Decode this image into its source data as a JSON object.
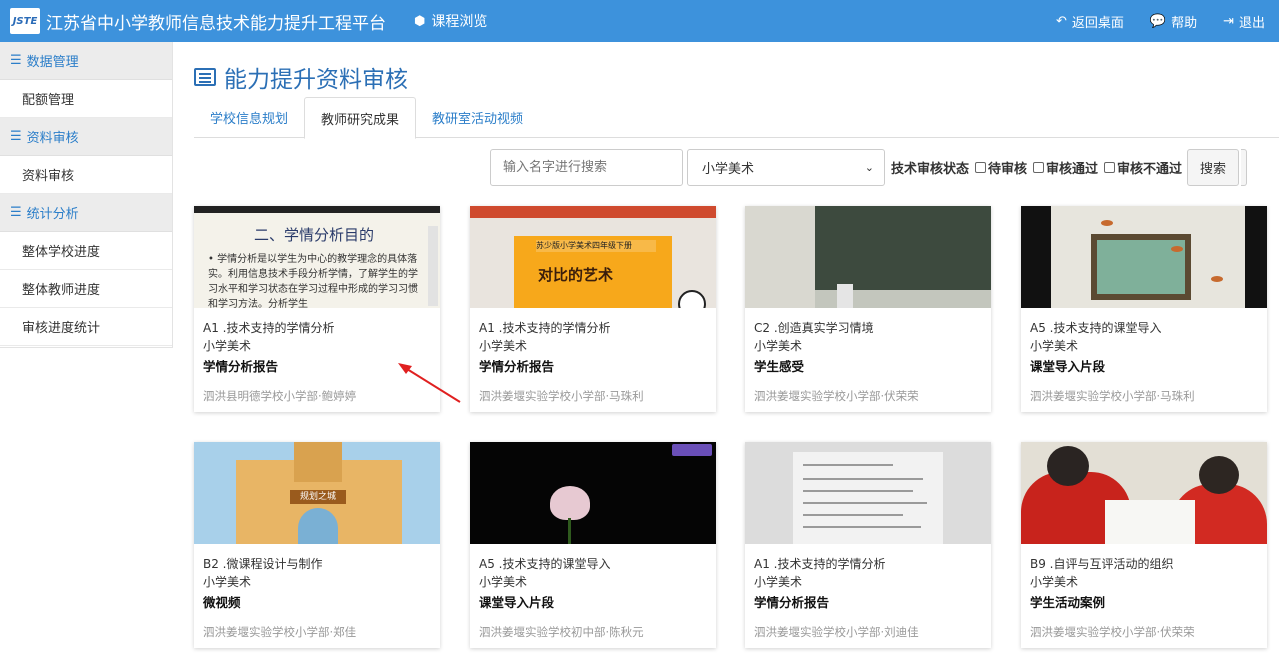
{
  "header": {
    "logo_text": "JSTE",
    "site_title": "江苏省中小学教师信息技术能力提升工程平台",
    "course_nav": "课程浏览",
    "links": [
      {
        "label": "返回桌面",
        "icon": "return-icon"
      },
      {
        "label": "帮助",
        "icon": "chat-bubble-icon"
      },
      {
        "label": "退出",
        "icon": "sign-out-icon"
      }
    ]
  },
  "sidebar": {
    "groups": [
      {
        "label": "数据管理",
        "items": [
          "配额管理"
        ]
      },
      {
        "label": "资料审核",
        "items": [
          "资料审核"
        ]
      },
      {
        "label": "统计分析",
        "items": [
          "整体学校进度",
          "整体教师进度",
          "审核进度统计"
        ]
      }
    ]
  },
  "page_title": "能力提升资料审核",
  "tabs": [
    {
      "label": "学校信息规划",
      "active": false
    },
    {
      "label": "教师研究成果",
      "active": true
    },
    {
      "label": "教研室活动视频",
      "active": false
    }
  ],
  "filters": {
    "search_placeholder": "输入名字进行搜索",
    "subject_selected": "小学美术",
    "status_label": "技术审核状态",
    "status_options": [
      "待审核",
      "审核通过",
      "审核不通过"
    ],
    "search_button": "搜索"
  },
  "cards": [
    {
      "code": "A1 .技术支持的学情分析",
      "subject": "小学美术",
      "title": "学情分析报告",
      "author": "泗洪县明德学校小学部·鲍婷婷",
      "thumb_heading": "二、学情分析目的",
      "thumb_text": "• 学情分析是以学生为中心的教学理念的具体落实。利用信息技术手段分析学情，了解学生的学习水平和学习状态在学习过程中形成的学习习惯和学习方法。分析学生"
    },
    {
      "code": "A1 .技术支持的学情分析",
      "subject": "小学美术",
      "title": "学情分析报告",
      "author": "泗洪姜堰实验学校小学部·马珠利",
      "thumb_slide_title": "对比的艺术",
      "thumb_slide_sub": "苏少版小学美术四年级下册"
    },
    {
      "code": "C2 .创造真实学习情境",
      "subject": "小学美术",
      "title": "学生感受",
      "author": "泗洪姜堰实验学校小学部·伏荣荣"
    },
    {
      "code": "A5 .技术支持的课堂导入",
      "subject": "小学美术",
      "title": "课堂导入片段",
      "author": "泗洪姜堰实验学校小学部·马珠利"
    },
    {
      "code": "B2 .微课程设计与制作",
      "subject": "小学美术",
      "title": "微视频",
      "author": "泗洪姜堰实验学校小学部·郑佳",
      "thumb_sign": "规划之城"
    },
    {
      "code": "A5 .技术支持的课堂导入",
      "subject": "小学美术",
      "title": "课堂导入片段",
      "author": "泗洪姜堰实验学校初中部·陈秋元"
    },
    {
      "code": "A1 .技术支持的学情分析",
      "subject": "小学美术",
      "title": "学情分析报告",
      "author": "泗洪姜堰实验学校小学部·刘迪佳"
    },
    {
      "code": "B9 .自评与互评活动的组织",
      "subject": "小学美术",
      "title": "学生活动案例",
      "author": "泗洪姜堰实验学校小学部·伏荣荣"
    }
  ],
  "colors": {
    "header_bg": "#3d92dc",
    "accent": "#2b7ec9",
    "annotation_arrow": "#e02020"
  }
}
